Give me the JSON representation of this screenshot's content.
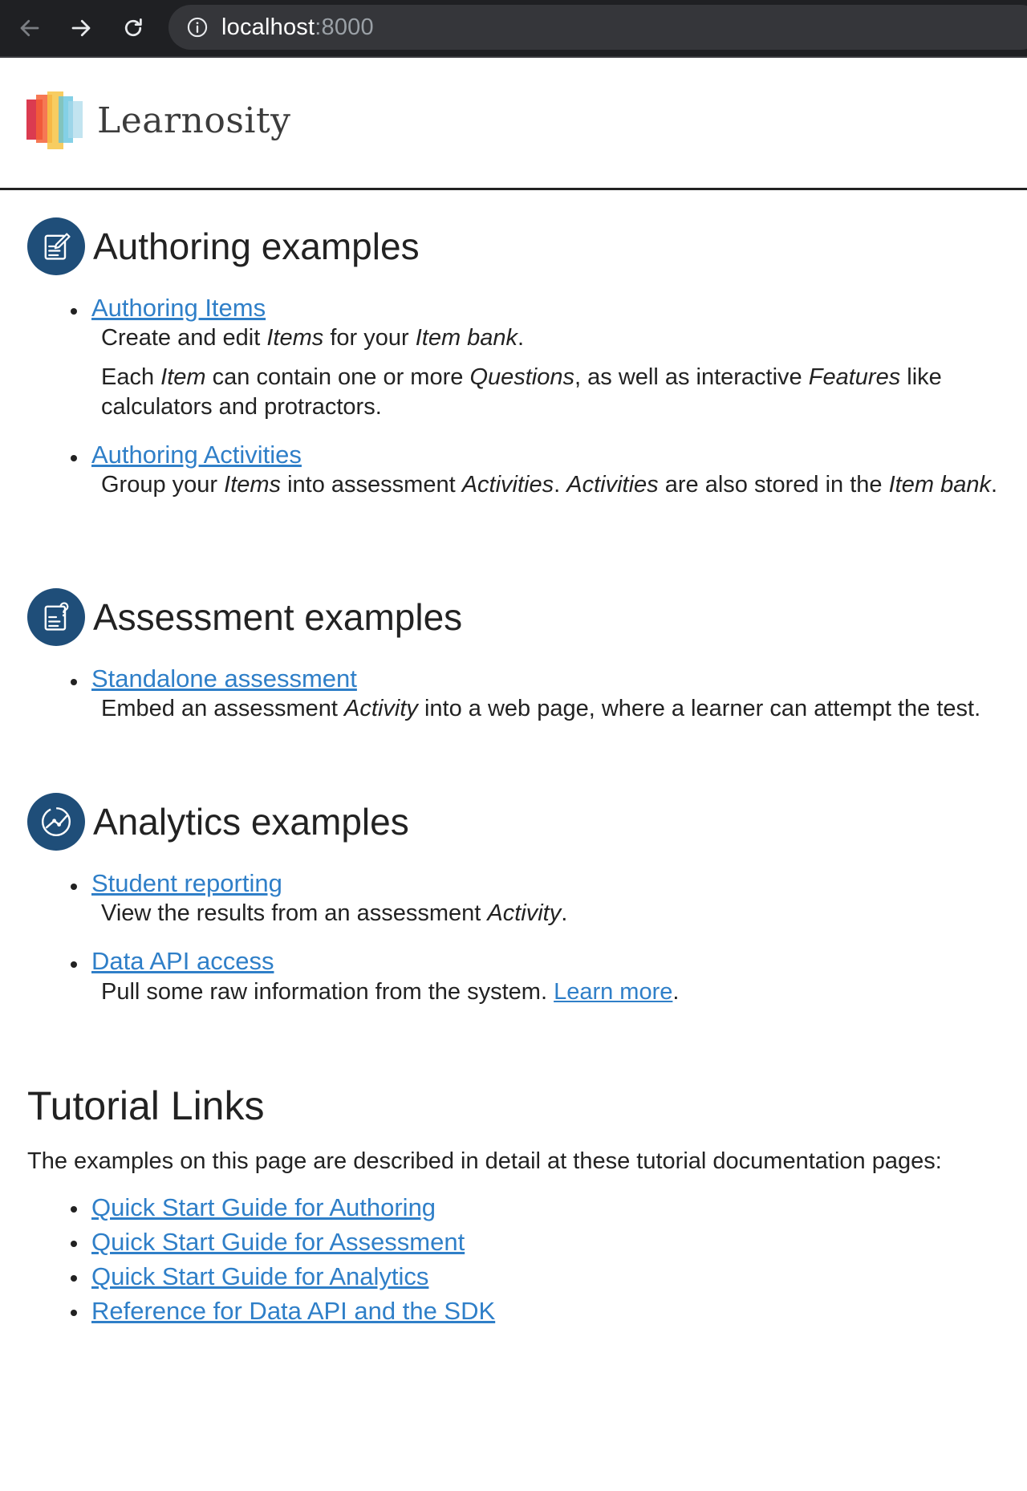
{
  "browser": {
    "url_host": "localhost",
    "url_port": ":8000",
    "back_icon": "arrow-left-icon",
    "forward_icon": "arrow-right-icon",
    "reload_icon": "reload-icon",
    "info_icon": "info-icon"
  },
  "brand": {
    "name": "Learnosity",
    "colors": [
      "#d7263d",
      "#f46036",
      "#f6c445",
      "#5bc0de",
      "#a8d8ea"
    ]
  },
  "accent": "#1f4e79",
  "link_color": "#2f7fc8",
  "sections": {
    "authoring": {
      "title": "Authoring examples",
      "icon": "authoring-edit-icon",
      "items": [
        {
          "link": "Authoring Items",
          "desc1": {
            "a": "Create and edit ",
            "b": "Items",
            "c": " for your ",
            "d": "Item bank",
            "e": "."
          },
          "desc2": {
            "a": "Each ",
            "b": "Item",
            "c": " can contain one or more ",
            "d": "Questions",
            "e": ", as well as interactive ",
            "f": "Features",
            "g": " like calculators and protractors."
          }
        },
        {
          "link": "Authoring Activities",
          "desc1": {
            "a": "Group your ",
            "b": "Items",
            "c": " into assessment ",
            "d": "Activities",
            "e": ". ",
            "f": "Activities",
            "g": " are also stored in the ",
            "h": "Item bank",
            "i": "."
          }
        }
      ]
    },
    "assessment": {
      "title": "Assessment examples",
      "icon": "assessment-question-icon",
      "items": [
        {
          "link": "Standalone assessment",
          "desc1": {
            "a": "Embed an assessment ",
            "b": "Activity",
            "c": " into a web page, where a learner can attempt the test."
          }
        }
      ]
    },
    "analytics": {
      "title": "Analytics examples",
      "icon": "analytics-chart-icon",
      "items": [
        {
          "link": "Student reporting",
          "desc1": {
            "a": "View the results from an assessment ",
            "b": "Activity",
            "c": "."
          }
        },
        {
          "link": "Data API access",
          "desc1": {
            "a": "Pull some raw information from the system. ",
            "learn_more": "Learn more",
            "b": "."
          }
        }
      ]
    }
  },
  "tutorials": {
    "title": "Tutorial Links",
    "intro": "The examples on this page are described in detail at these tutorial documentation pages:",
    "links": [
      "Quick Start Guide for Authoring",
      "Quick Start Guide for Assessment",
      "Quick Start Guide for Analytics",
      "Reference for Data API and the SDK"
    ]
  }
}
